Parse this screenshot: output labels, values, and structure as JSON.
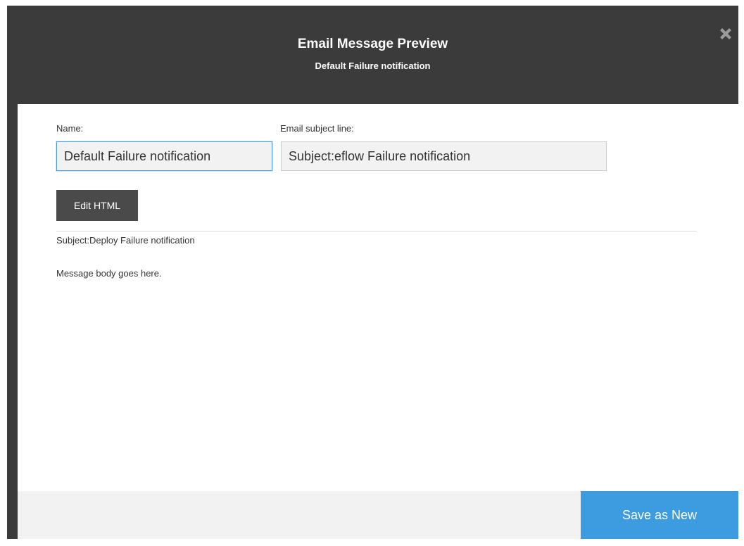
{
  "dialog": {
    "title": "Email Message Preview",
    "subtitle": "Default Failure notification",
    "close_icon": "close-icon"
  },
  "form": {
    "name_label": "Name:",
    "name_value": "Default Failure notification",
    "subject_label": "Email subject line:",
    "subject_value": "Subject:eflow Failure notification"
  },
  "toolbar": {
    "edit_html_label": "Edit HTML"
  },
  "preview": {
    "subject_text": "Subject:Deploy Failure notification",
    "body_text": "Message body goes here."
  },
  "footer": {
    "save_as_new_label": "Save as New"
  },
  "colors": {
    "header_bg": "#3b3b3b",
    "accent": "#3d9be0",
    "focus_border": "#4a9ad6",
    "footer_bg": "#f2f2f2"
  }
}
